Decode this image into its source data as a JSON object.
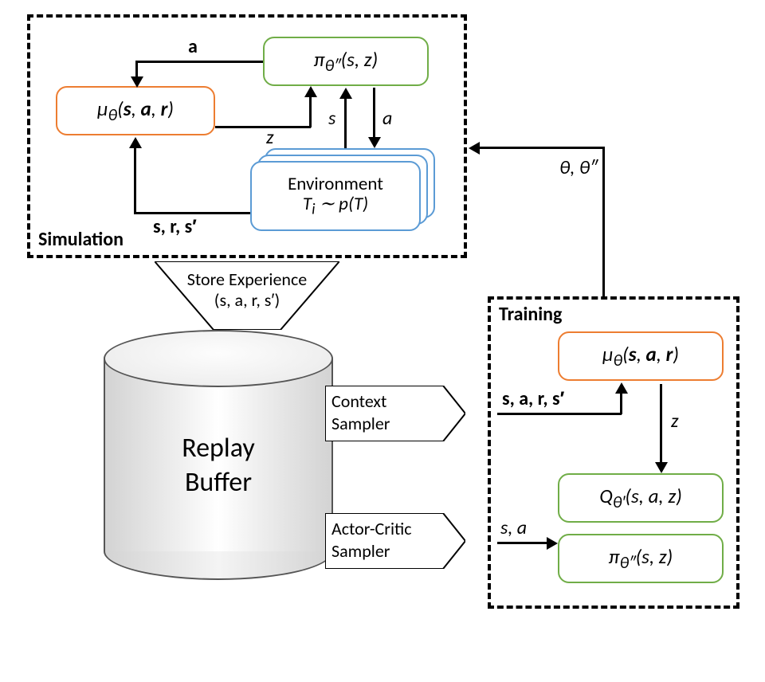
{
  "simulation": {
    "label": "Simulation",
    "mu": "μ<sub>θ</sub>(<b>s</b>, <b>a</b>, <b>r</b>)",
    "pi": "π<sub>θ″</sub>(s, z)",
    "env_title": "Environment",
    "env_formula": "T<sub>i</sub> ∼ p(T)",
    "edge_a": "a",
    "edge_z": "z",
    "edge_s": "s",
    "edge_a2": "a",
    "edge_srs": "s, r, s′"
  },
  "store": {
    "line1": "Store Experience",
    "line2": "(s, a, r, s′)"
  },
  "buffer": {
    "line1": "Replay",
    "line2": "Buffer"
  },
  "samplers": {
    "context": {
      "line1": "Context",
      "line2": "Sampler"
    },
    "actor": {
      "line1": "Actor-Critic",
      "line2": "Sampler"
    }
  },
  "training": {
    "label": "Training",
    "mu": "μ<sub>θ</sub>(<b>s</b>, <b>a</b>, <b>r</b>)",
    "q": "Q<sub>θ′</sub>(s, a, z)",
    "pi": "π<sub>θ″</sub>(s, z)",
    "edge_context": "s, a, r, s′",
    "edge_z": "z",
    "edge_sa": "s, a",
    "edge_params": "θ, θ″"
  }
}
